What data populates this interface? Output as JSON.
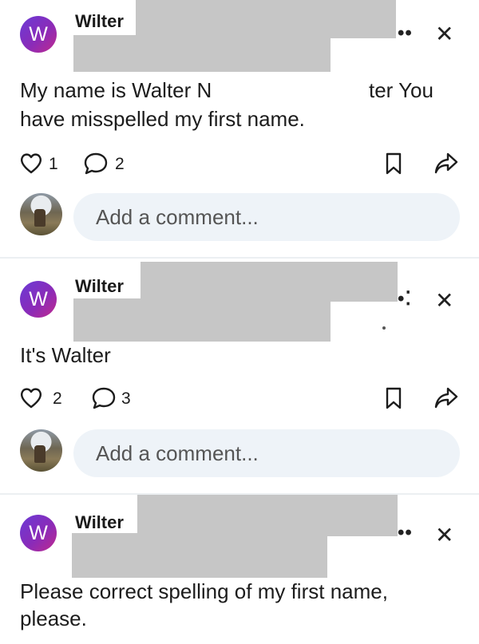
{
  "posts": [
    {
      "avatar_letter": "W",
      "author": "Wilter",
      "text_line1_left": "My name is Walter N",
      "text_line1_right": "ter You",
      "text_line2": "have misspelled my first name.",
      "likes": "1",
      "comments": "2",
      "comment_placeholder": "Add a comment..."
    },
    {
      "avatar_letter": "W",
      "author": "Wilter",
      "text": "It's Walter",
      "likes": "2",
      "comments": "3",
      "comment_placeholder": "Add a comment..."
    },
    {
      "avatar_letter": "W",
      "author": "Wilter",
      "text_line1": "Please correct spelling of my first name,",
      "text_line2": "please."
    }
  ],
  "icons": {
    "more": "more-dots-icon",
    "close": "close-icon",
    "like": "heart-icon",
    "comment": "comment-bubble-icon",
    "save": "bookmark-icon",
    "share": "share-arrow-icon"
  },
  "colors": {
    "avatar_gradient_start": "#6a3bd6",
    "avatar_gradient_end": "#c02a8e",
    "comment_box_bg": "#eef3f8",
    "redaction": "#c6c6c6"
  }
}
